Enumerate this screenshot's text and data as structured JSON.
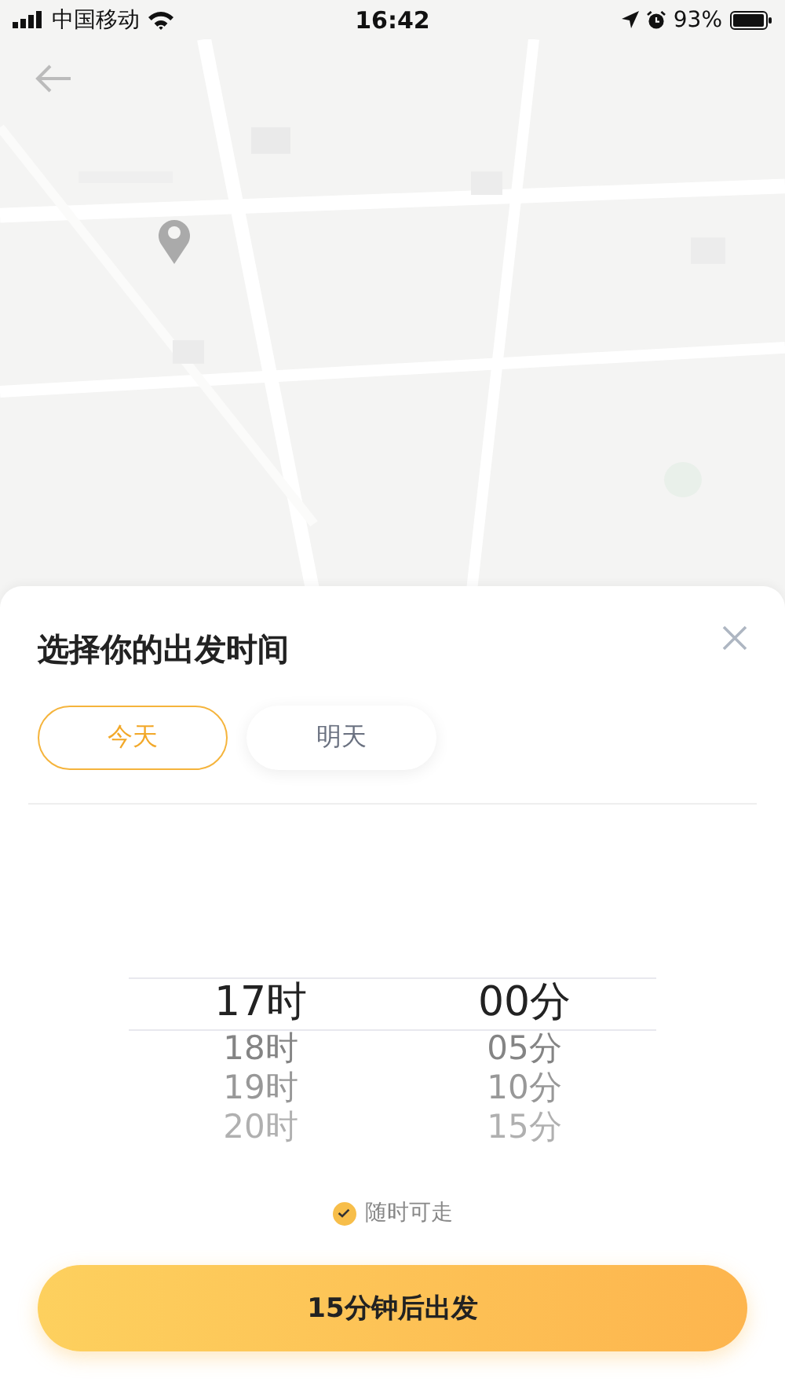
{
  "status_bar": {
    "carrier": "中国移动",
    "time": "16:42",
    "battery": "93%"
  },
  "sheet": {
    "title": "选择你的出发时间",
    "day_tabs": [
      {
        "label": "今天",
        "selected": true
      },
      {
        "label": "明天",
        "selected": false
      }
    ],
    "picker": {
      "hours": [
        {
          "label": "17时",
          "selected": true
        },
        {
          "label": "18时",
          "selected": false
        },
        {
          "label": "19时",
          "selected": false
        },
        {
          "label": "20时",
          "selected": false
        }
      ],
      "minutes": [
        {
          "label": "00分",
          "selected": true
        },
        {
          "label": "05分",
          "selected": false
        },
        {
          "label": "10分",
          "selected": false
        },
        {
          "label": "15分",
          "selected": false
        }
      ]
    },
    "anytime": {
      "label": "随时可走",
      "checked": true
    },
    "confirm_button": "15分钟后出发"
  }
}
